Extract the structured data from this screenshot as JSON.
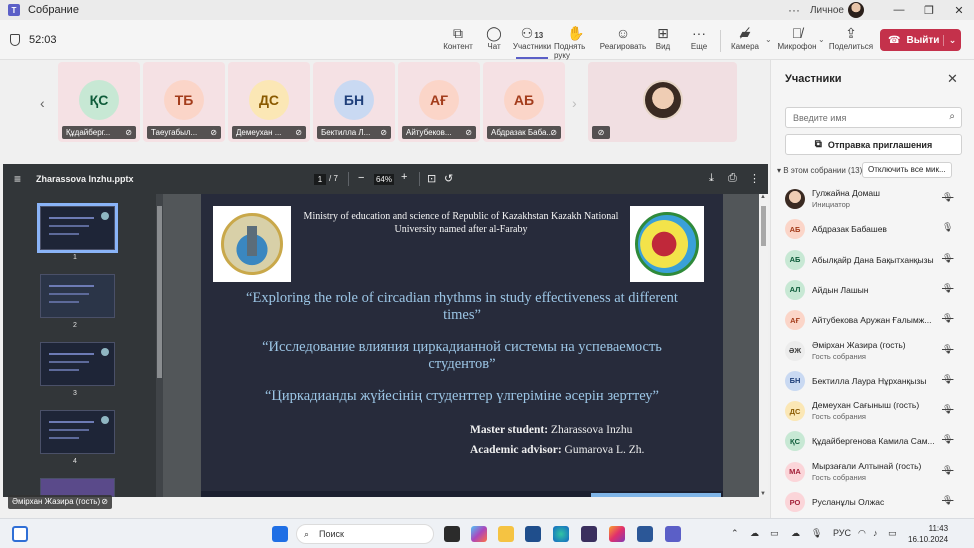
{
  "window": {
    "title": "Собрание",
    "user": "Личное"
  },
  "toolbar": {
    "timer": "52:03",
    "buttons": [
      {
        "label": "Контент",
        "icon": "share-content-icon"
      },
      {
        "label": "Чат",
        "icon": "chat-icon"
      },
      {
        "label": "Участники",
        "icon": "people-icon",
        "count": "13"
      },
      {
        "label": "Поднять руку",
        "icon": "raise-hand-icon"
      },
      {
        "label": "Реагировать",
        "icon": "react-icon"
      },
      {
        "label": "Вид",
        "icon": "view-icon"
      },
      {
        "label": "Еще",
        "icon": "more-icon"
      },
      {
        "label": "Камера",
        "icon": "camera-off-icon"
      },
      {
        "label": "Микрофон",
        "icon": "mic-off-icon"
      },
      {
        "label": "Поделиться",
        "icon": "share-icon"
      }
    ],
    "leave_label": "Выйти",
    "accent": "#5b5fc7",
    "leave_color": "#c4314b"
  },
  "tiles": [
    {
      "initials": "ҚС",
      "name": "Құдайберг...",
      "bg": "#c7e8d4",
      "fg": "#0e5c3a"
    },
    {
      "initials": "ТБ",
      "name": "Таеугабыл...",
      "bg": "#fbd5c8",
      "fg": "#a33c1b"
    },
    {
      "initials": "ДС",
      "name": "Демеухан ...",
      "bg": "#fbe7b5",
      "fg": "#8a5a00"
    },
    {
      "initials": "БН",
      "name": "Бектилла Л...",
      "bg": "#c9d9f2",
      "fg": "#1f3f7a"
    },
    {
      "initials": "АҒ",
      "name": "Айтубеков...",
      "bg": "#fbd5c8",
      "fg": "#a33c1b"
    },
    {
      "initials": "АБ",
      "name": "Абдразак Баба...",
      "bg": "#fbd5c8",
      "fg": "#a33c1b"
    }
  ],
  "pdf": {
    "filename": "Zharassova Inzhu.pptx",
    "page": "1",
    "total": "/ 7",
    "zoom": "64%",
    "thumb_numbers": [
      "1",
      "2",
      "3",
      "4"
    ]
  },
  "slide": {
    "institution": "Ministry of education and science of Republic of Kazakhstan Kazakh National University named after al-Faraby",
    "title_en": "“Exploring the role of circadian rhythms in study effectiveness at different times”",
    "title_ru": "“Исследование влияния циркадианной системы на успеваемость студентов”",
    "title_kz": "“Циркадианды жүйесінің студенттер үлгеріміне әсерін зерттеу”",
    "student_label": "Master student:",
    "student": "Zharassova Inzhu",
    "advisor_label": "Academic advisor:",
    "advisor": "Gumarova L. Zh."
  },
  "presenter_label": "Әмірхан Жазира (гость)",
  "participants": {
    "title": "Участники",
    "search_placeholder": "Введите имя",
    "invite_label": "Отправка приглашения",
    "section": "В этом собрании (13)",
    "mute_all": "Отключить все мик...",
    "people": [
      {
        "initials": "",
        "name": "Гулжайна Домаш",
        "sub": "Инициатор",
        "photo": true,
        "mic": "off",
        "bg": "",
        "fg": ""
      },
      {
        "initials": "АБ",
        "name": "Абдразак Бабашев",
        "sub": "",
        "mic": "on",
        "bg": "#fbd5c8",
        "fg": "#a33c1b"
      },
      {
        "initials": "АБ",
        "name": "Абылқайр Дана Бақытханқызы",
        "sub": "",
        "mic": "off",
        "bg": "#c7e8d4",
        "fg": "#0e5c3a"
      },
      {
        "initials": "АЛ",
        "name": "Айдын Лашын",
        "sub": "",
        "mic": "off",
        "bg": "#c7e8d4",
        "fg": "#0e5c3a"
      },
      {
        "initials": "АҒ",
        "name": "Айтубекова Аружан Ғалымж...",
        "sub": "",
        "mic": "off",
        "bg": "#fbd5c8",
        "fg": "#a33c1b"
      },
      {
        "initials": "ӘЖ",
        "name": "Әмірхан Жазира (гость)",
        "sub": "Гость собрания",
        "mic": "off",
        "bg": "#ececec",
        "fg": "#424242"
      },
      {
        "initials": "БН",
        "name": "Бектилла Лаура Нұрханқызы",
        "sub": "",
        "mic": "off",
        "bg": "#c9d9f2",
        "fg": "#1f3f7a"
      },
      {
        "initials": "ДС",
        "name": "Демеухан Сағыныш (гость)",
        "sub": "Гость собрания",
        "mic": "off",
        "bg": "#fbe7b5",
        "fg": "#8a5a00"
      },
      {
        "initials": "ҚС",
        "name": "Құдайбергенова Камила Сам...",
        "sub": "",
        "mic": "off",
        "bg": "#c7e8d4",
        "fg": "#0e5c3a"
      },
      {
        "initials": "МА",
        "name": "Мырзағали Алтынай (гость)",
        "sub": "Гость собрания",
        "mic": "off",
        "bg": "#fbd5d9",
        "fg": "#a3213a"
      },
      {
        "initials": "РО",
        "name": "Русланұлы Олжас",
        "sub": "",
        "mic": "off",
        "bg": "#fbd5d9",
        "fg": "#a3213a"
      }
    ]
  },
  "taskbar": {
    "search_label": "Поиск",
    "lang": "РУС",
    "time": "11:43",
    "date": "16.10.2024"
  }
}
